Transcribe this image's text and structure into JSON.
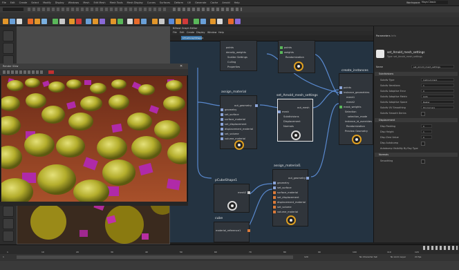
{
  "app": {
    "menus": [
      "File",
      "Edit",
      "Create",
      "Select",
      "Modify",
      "Display",
      "Windows",
      "Mesh",
      "Edit Mesh",
      "Mesh Tools",
      "Mesh Display",
      "Curves",
      "Surfaces",
      "Deform",
      "UV",
      "Generate",
      "Cache",
      "Arnold",
      "Help"
    ],
    "workspace_label": "Workspace:",
    "workspace_value": "Maya Classic"
  },
  "render_view": {
    "title": "Render View"
  },
  "graph_editor": {
    "title": "Bifrost Graph Editor",
    "menus": [
      "File",
      "Edit",
      "Create",
      "Display",
      "Window",
      "Help"
    ],
    "tab": "bifrostGraphShape1",
    "nodes": {
      "top_left": {
        "ports": [
          "points",
          "density_weights",
          "Scatter Settings",
          "Culling",
          "Properties"
        ]
      },
      "top_mid": {
        "ports": [
          "points",
          "weights",
          "Randomization"
        ]
      },
      "assign_material": {
        "title": "assign_material",
        "out": "out_geometry",
        "ports": [
          "geometry",
          "set_surface",
          "surface_material",
          "set_displacement",
          "displacement_material",
          "set_volume",
          "volume_material"
        ]
      },
      "set_arnold": {
        "title": "set_Arnold_mesh_settings",
        "out": "out_mesh",
        "ports": [
          "mesh",
          "Subdivisions",
          "Displacement",
          "Normals"
        ]
      },
      "create_instances": {
        "title": "create_instances",
        "ports": [
          "points",
          "instance_geometries",
          "mesh1",
          "mesh2",
          "mask_weights",
          "Selection",
          "selection_mode",
          "instance_id_overrides",
          "Randomization",
          "Preview Geometry"
        ]
      },
      "assign_material1": {
        "title": "assign_material1",
        "out": "out_geometry",
        "ports": [
          "geometry",
          "set_surface",
          "surface_material",
          "set_displacement",
          "displacement_material",
          "set_volume",
          "volume_material"
        ]
      },
      "pCubeShape1": {
        "title": "pCubeShape1",
        "out": "mesh2"
      },
      "cube": {
        "title": "cube",
        "out": "material_reference1"
      }
    }
  },
  "attribute_editor": {
    "tabs": [
      "Parameters",
      "Info"
    ],
    "node_title": "set_Arnold_mesh_settings",
    "node_type": "Type: set_Arnold_mesh_settings",
    "name_label": "Name",
    "name_value": "set_Arnold_mesh_settings",
    "sections": [
      {
        "title": "Subdivisions",
        "rows": [
          {
            "label": "Subdiv Type",
            "value": "Catmull-Clark"
          },
          {
            "label": "Subdiv Iterations",
            "value": "1"
          },
          {
            "label": "Subdiv Adaptive Error",
            "value": "0"
          },
          {
            "label": "Subdiv Adaptive Metric",
            "value": "Auto"
          },
          {
            "label": "Subdiv Adaptive Space",
            "value": "Raster"
          },
          {
            "label": "Subdiv UV Smoothing",
            "value": "Pin Corners"
          },
          {
            "label": "Subdiv Smooth Derivs",
            "value": ""
          }
        ]
      },
      {
        "title": "Displacement",
        "rows": [
          {
            "label": "Disp Padding",
            "value": "0"
          },
          {
            "label": "Disp Height",
            "value": "1"
          },
          {
            "label": "Disp Zero Value",
            "value": "0"
          },
          {
            "label": "Disp Autobump",
            "value": ""
          },
          {
            "label": "Autobump Visibility By Ray Type",
            "value": ""
          }
        ]
      },
      {
        "title": "Normals",
        "rows": [
          {
            "label": "Smoothing",
            "value": ""
          }
        ]
      }
    ]
  },
  "timeline": {
    "ticks": [
      "1",
      "10",
      "20",
      "30",
      "40",
      "50",
      "60",
      "70",
      "80",
      "90",
      "100",
      "110",
      "120"
    ],
    "start": "1",
    "end": "120",
    "no_char_set": "No Character Set",
    "no_anim_layer": "No Anim Layer",
    "fps": "24 fps"
  },
  "colors": {
    "accent": "#3a75a8",
    "selection_ring": "#e0a020",
    "graph_bg": "#243341"
  }
}
